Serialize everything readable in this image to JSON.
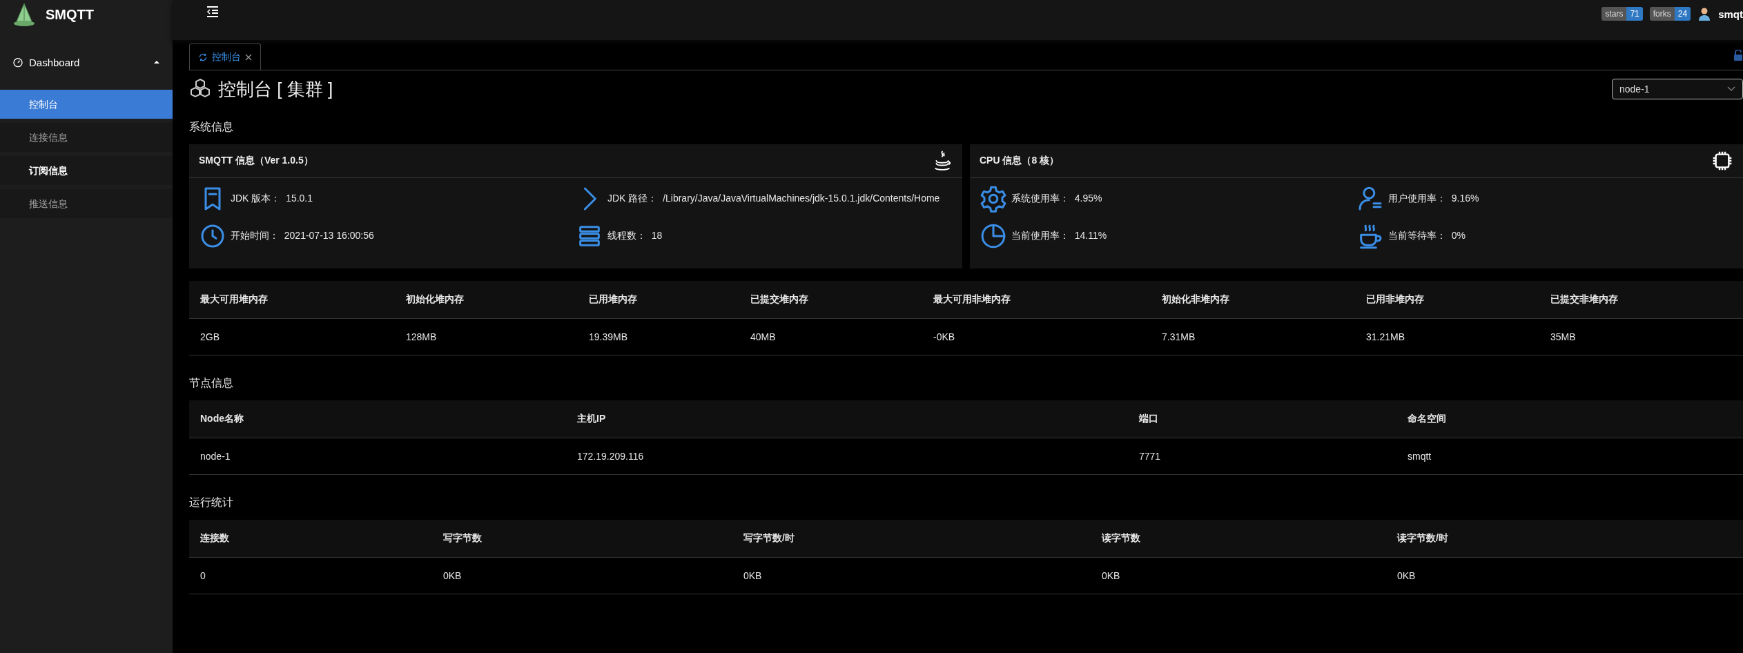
{
  "sidebar": {
    "logo_text": "SMQTT",
    "group": {
      "label": "Dashboard",
      "expanded": true
    },
    "items": [
      {
        "label": "控制台",
        "selected": true,
        "hovered": false
      },
      {
        "label": "连接信息",
        "selected": false,
        "hovered": false
      },
      {
        "label": "订阅信息",
        "selected": false,
        "hovered": true
      },
      {
        "label": "推送信息",
        "selected": false,
        "hovered": false
      }
    ]
  },
  "header": {
    "badges": [
      {
        "label": "stars",
        "count": "71"
      },
      {
        "label": "forks",
        "count": "24"
      }
    ],
    "user": "smqt"
  },
  "tabs": [
    {
      "label": "控制台",
      "selected": true
    }
  ],
  "page": {
    "title": "控制台 [ 集群 ]",
    "node_select": {
      "value": "node-1"
    }
  },
  "system_section": {
    "heading": "系统信息",
    "cards": [
      {
        "title": "SMQTT 信息（Ver 1.0.5）",
        "items": [
          {
            "label": "JDK 版本：",
            "value": "15.0.1"
          },
          {
            "label": "JDK 路径：",
            "value": "/Library/Java/JavaVirtualMachines/jdk-15.0.1.jdk/Contents/Home"
          },
          {
            "label": "开始时间：",
            "value": "2021-07-13 16:00:56"
          },
          {
            "label": "线程数：",
            "value": "18"
          }
        ]
      },
      {
        "title": "CPU 信息（8 核）",
        "items": [
          {
            "label": "系统使用率：",
            "value": "4.95%"
          },
          {
            "label": "用户使用率：",
            "value": "9.16%"
          },
          {
            "label": "当前使用率：",
            "value": "14.11%"
          },
          {
            "label": "当前等待率：",
            "value": "0%"
          }
        ]
      }
    ]
  },
  "memory_table": {
    "columns": [
      "最大可用堆内存",
      "初始化堆内存",
      "已用堆内存",
      "已提交堆内存",
      "最大可用非堆内存",
      "初始化非堆内存",
      "已用非堆内存",
      "已提交非堆内存"
    ],
    "rows": [
      [
        "2GB",
        "128MB",
        "19.39MB",
        "40MB",
        "-0KB",
        "7.31MB",
        "31.21MB",
        "35MB"
      ]
    ]
  },
  "node_section": {
    "heading": "节点信息",
    "columns": [
      "Node名称",
      "主机IP",
      "端口",
      "命名空间"
    ],
    "rows": [
      [
        "node-1",
        "172.19.209.116",
        "7771",
        "smqtt"
      ]
    ]
  },
  "stats_section": {
    "heading": "运行统计",
    "columns": [
      "连接数",
      "写字节数",
      "写字节数/时",
      "读字节数",
      "读字节数/时"
    ],
    "rows": [
      [
        "0",
        "0KB",
        "0KB",
        "0KB",
        "0KB"
      ]
    ]
  }
}
